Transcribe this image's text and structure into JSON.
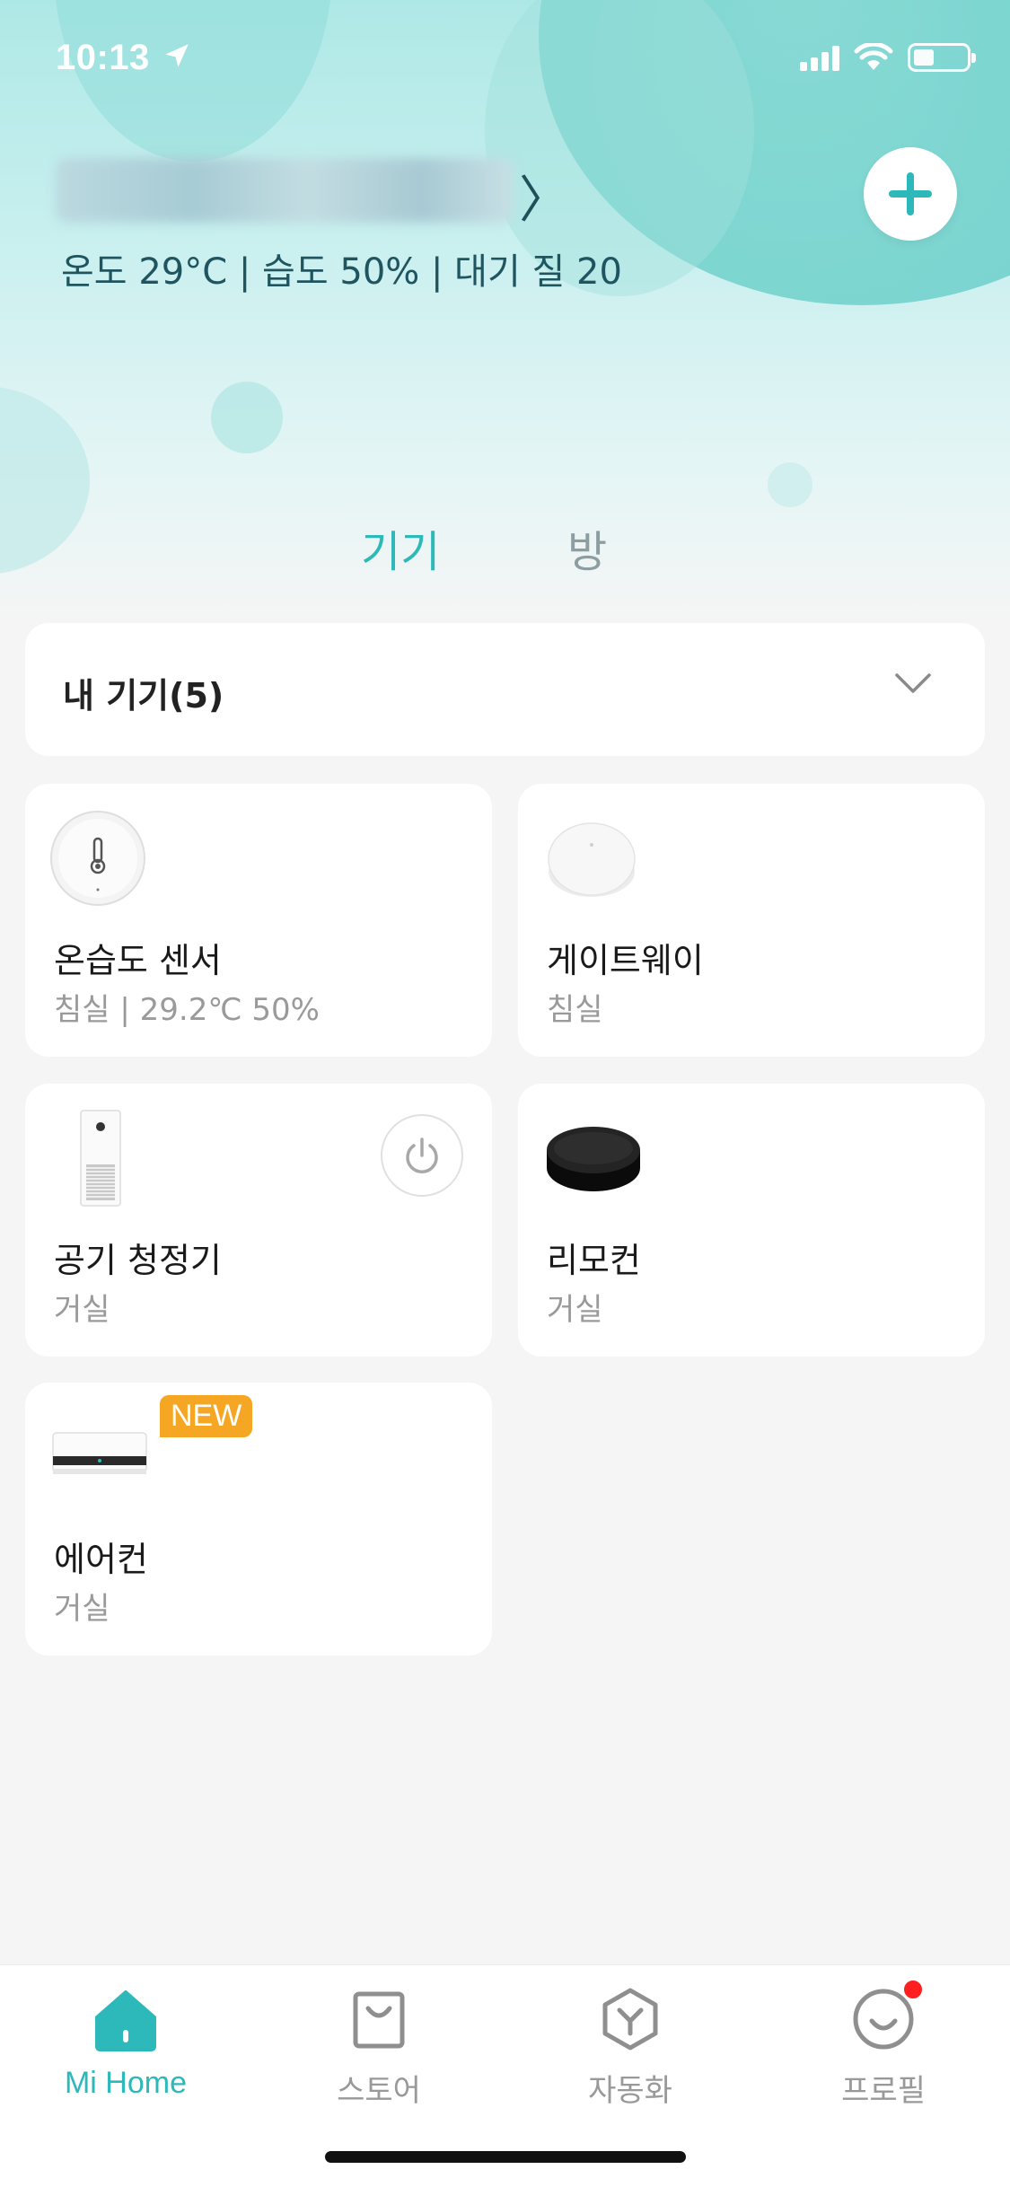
{
  "status_bar": {
    "time": "10:13"
  },
  "header": {
    "climate_text": "온도 29°C | 습도 50% | 대기 질 20",
    "tabs": [
      {
        "label": "기기",
        "active": true
      },
      {
        "label": "방",
        "active": false
      }
    ],
    "accent_color": "#2db8ba"
  },
  "device_filter": {
    "label": "내 기기(5)"
  },
  "devices": [
    {
      "name": "온습도 센서",
      "sub": "침실 | 29.2℃ 50%",
      "icon": "thermometer-sensor-icon"
    },
    {
      "name": "게이트웨이",
      "sub": "침실",
      "icon": "gateway-icon"
    },
    {
      "name": "공기 청정기",
      "sub": "거실",
      "icon": "air-purifier-icon"
    },
    {
      "name": "리모컨",
      "sub": "거실",
      "icon": "ir-remote-icon"
    },
    {
      "name": "에어컨",
      "sub": "거실",
      "icon": "air-conditioner-icon",
      "badge": "NEW"
    }
  ],
  "bottom_nav": [
    {
      "label": "Mi Home",
      "icon": "home-icon",
      "active": true
    },
    {
      "label": "스토어",
      "icon": "store-bag-icon",
      "active": false
    },
    {
      "label": "자동화",
      "icon": "automation-icon",
      "active": false
    },
    {
      "label": "프로필",
      "icon": "profile-icon",
      "active": false,
      "notification": true
    }
  ]
}
